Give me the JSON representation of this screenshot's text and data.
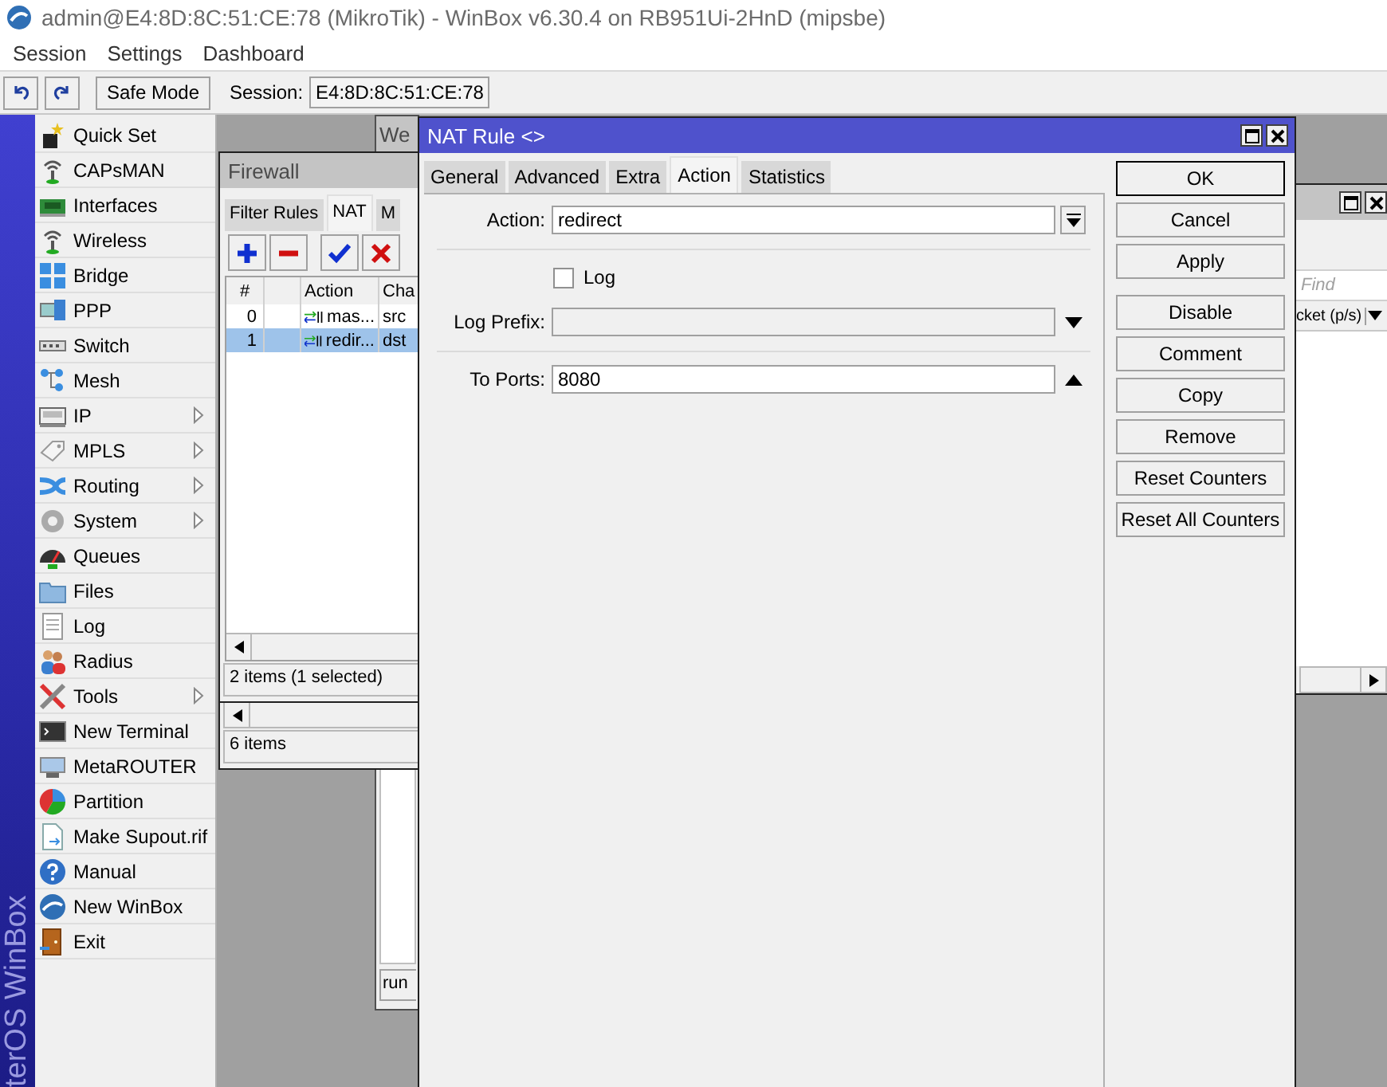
{
  "window": {
    "title": "admin@E4:8D:8C:51:CE:78 (MikroTik) - WinBox v6.30.4 on RB951Ui-2HnD (mipsbe)"
  },
  "menu_bar": [
    "Session",
    "Settings",
    "Dashboard"
  ],
  "toolbar": {
    "safe_mode": "Safe Mode",
    "session_label": "Session:",
    "session": "E4:8D:8C:51:CE:78"
  },
  "brand": "terOS WinBox",
  "sidebar": {
    "items": [
      {
        "label": "Quick Set",
        "submenu": false
      },
      {
        "label": "CAPsMAN",
        "submenu": false
      },
      {
        "label": "Interfaces",
        "submenu": false
      },
      {
        "label": "Wireless",
        "submenu": false
      },
      {
        "label": "Bridge",
        "submenu": false
      },
      {
        "label": "PPP",
        "submenu": false
      },
      {
        "label": "Switch",
        "submenu": false
      },
      {
        "label": "Mesh",
        "submenu": false
      },
      {
        "label": "IP",
        "submenu": true
      },
      {
        "label": "MPLS",
        "submenu": true
      },
      {
        "label": "Routing",
        "submenu": true
      },
      {
        "label": "System",
        "submenu": true
      },
      {
        "label": "Queues",
        "submenu": false
      },
      {
        "label": "Files",
        "submenu": false
      },
      {
        "label": "Log",
        "submenu": false
      },
      {
        "label": "Radius",
        "submenu": false
      },
      {
        "label": "Tools",
        "submenu": true
      },
      {
        "label": "New Terminal",
        "submenu": false
      },
      {
        "label": "MetaROUTER",
        "submenu": false
      },
      {
        "label": "Partition",
        "submenu": false
      },
      {
        "label": "Make Supout.rif",
        "submenu": false
      },
      {
        "label": "Manual",
        "submenu": false
      },
      {
        "label": "New WinBox",
        "submenu": false
      },
      {
        "label": "Exit",
        "submenu": false
      }
    ]
  },
  "web_window": {
    "title": "We",
    "status": "run"
  },
  "list_window": {
    "status": "6 items"
  },
  "traffic_window": {
    "search": {
      "placeholder": "Find"
    },
    "column": "cket (p/s)"
  },
  "firewall": {
    "title": "Firewall",
    "tabs": [
      {
        "label": "Filter Rules",
        "selected": false
      },
      {
        "label": "NAT",
        "selected": true
      },
      {
        "label": "M",
        "selected": false
      }
    ],
    "columns": [
      "#",
      "Action",
      "Cha"
    ],
    "rows": [
      {
        "number": "0",
        "action": "mas...",
        "chain": "src",
        "selected": false
      },
      {
        "number": "1",
        "action": "redir...",
        "chain": "dst",
        "selected": true
      }
    ],
    "status": "2 items (1 selected)"
  },
  "nat_rule": {
    "title": "NAT Rule <>",
    "tabs": [
      {
        "label": "General",
        "selected": false
      },
      {
        "label": "Advanced",
        "selected": false
      },
      {
        "label": "Extra",
        "selected": false
      },
      {
        "label": "Action",
        "selected": true
      },
      {
        "label": "Statistics",
        "selected": false
      }
    ],
    "fields": [
      {
        "kind": "select",
        "label": "Action:",
        "value": "redirect"
      },
      {
        "kind": "divider"
      },
      {
        "kind": "checkbox",
        "label": "Log",
        "checked": false
      },
      {
        "kind": "text",
        "label": "Log Prefix:",
        "disabled": true,
        "expanded": false
      },
      {
        "kind": "divider"
      },
      {
        "kind": "text",
        "label": "To Ports:",
        "value": "8080",
        "disabled": false,
        "expanded": true
      }
    ],
    "button_groups": [
      [
        {
          "label": "OK",
          "default": true
        },
        {
          "label": "Cancel",
          "default": false
        },
        {
          "label": "Apply",
          "default": false
        }
      ],
      [
        {
          "label": "Disable",
          "default": false
        },
        {
          "label": "Comment",
          "default": false
        },
        {
          "label": "Copy",
          "default": false
        },
        {
          "label": "Remove",
          "default": false
        },
        {
          "label": "Reset Counters",
          "default": false
        },
        {
          "label": "Reset All Counters",
          "default": false
        }
      ]
    ]
  }
}
